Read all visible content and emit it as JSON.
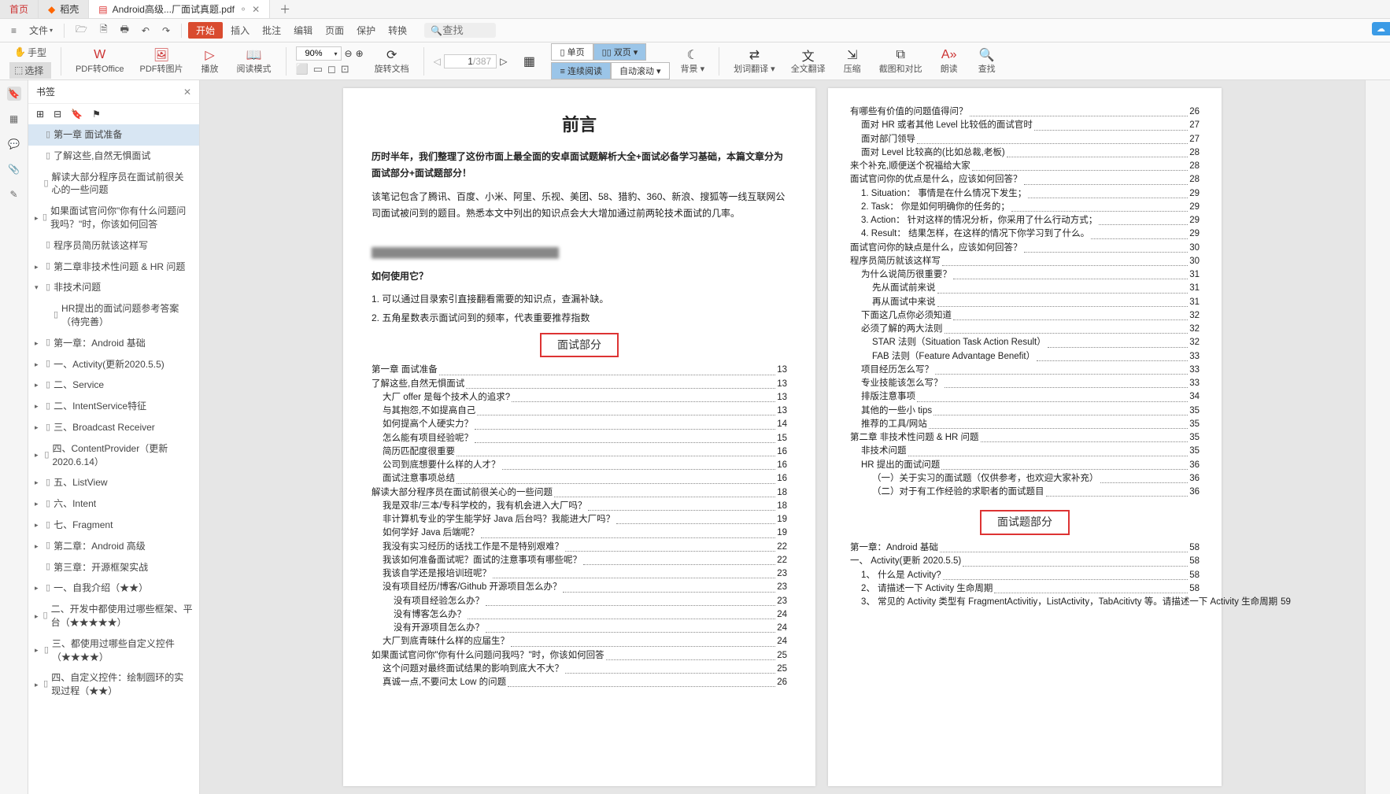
{
  "tabs": {
    "home": "首页",
    "doc1": "稻壳",
    "active": "Android高级...厂面试真题.pdf"
  },
  "menubar": {
    "file": "文件",
    "start": "开始",
    "insert": "插入",
    "review": "批注",
    "edit": "编辑",
    "page": "页面",
    "protect": "保护",
    "convert": "转换",
    "search_placeholder": "查找"
  },
  "toolbar": {
    "hand": "手型",
    "select": "选择",
    "pdf2office": "PDF转Office",
    "pdf2img": "PDF转图片",
    "play": "播放",
    "readmode": "阅读模式",
    "zoom": "90%",
    "rotate": "旋转文档",
    "page_current": "1",
    "page_total": "/387",
    "single": "单页",
    "double": "双页",
    "continuous": "连续阅读",
    "autoscroll": "自动滚动",
    "bg": "背景",
    "dict": "划词翻译",
    "fulltrans": "全文翻译",
    "compress": "压缩",
    "screenshot": "截图和对比",
    "read": "朗读",
    "find": "查找"
  },
  "sidebar": {
    "title": "书签",
    "items": [
      {
        "text": "第一章 面试准备",
        "sel": true,
        "ind": 0,
        "arr": ""
      },
      {
        "text": "了解这些,自然无惧面试",
        "ind": 0,
        "arr": ""
      },
      {
        "text": "解读大部分程序员在面试前很关心的一些问题",
        "ind": 0,
        "arr": ""
      },
      {
        "text": "如果面试官问你\"你有什么问题问我吗？\"时，你该如何回答",
        "ind": 0,
        "arr": "▸"
      },
      {
        "text": "程序员简历就该这样写",
        "ind": 0,
        "arr": ""
      },
      {
        "text": "第二章非技术性问题 & HR 问题",
        "ind": 0,
        "arr": "▸"
      },
      {
        "text": "非技术问题",
        "ind": 0,
        "arr": "▾"
      },
      {
        "text": "HR提出的面试问题参考答案（待完善）",
        "ind": 1,
        "arr": ""
      },
      {
        "text": "第一章：Android 基础",
        "ind": 0,
        "arr": "▸"
      },
      {
        "text": "一、Activity(更新2020.5.5)",
        "ind": 0,
        "arr": "▸"
      },
      {
        "text": "二、Service",
        "ind": 0,
        "arr": "▸"
      },
      {
        "text": "二、IntentService特征",
        "ind": 0,
        "arr": "▸"
      },
      {
        "text": "三、Broadcast Receiver",
        "ind": 0,
        "arr": "▸"
      },
      {
        "text": "四、ContentProvider（更新2020.6.14）",
        "ind": 0,
        "arr": "▸"
      },
      {
        "text": "五、ListView",
        "ind": 0,
        "arr": "▸"
      },
      {
        "text": "六、Intent",
        "ind": 0,
        "arr": "▸"
      },
      {
        "text": "七、Fragment",
        "ind": 0,
        "arr": "▸"
      },
      {
        "text": "第二章：Android 高级",
        "ind": 0,
        "arr": "▸"
      },
      {
        "text": "第三章：开源框架实战",
        "ind": 0,
        "arr": ""
      },
      {
        "text": "一、自我介绍（★★）",
        "ind": 0,
        "arr": "▸"
      },
      {
        "text": "二、开发中都使用过哪些框架、平台（★★★★★）",
        "ind": 0,
        "arr": "▸"
      },
      {
        "text": "三、都使用过哪些自定义控件（★★★★）",
        "ind": 0,
        "arr": "▸"
      },
      {
        "text": "四、自定义控件：绘制圆环的实现过程（★★）",
        "ind": 0,
        "arr": "▸"
      }
    ]
  },
  "doc_left": {
    "title": "前言",
    "p1": "历时半年，我们整理了这份市面上最全面的安卓面试题解析大全+面试必备学习基础，本篇文章分为面试部分+面试题部分！",
    "p2": "该笔记包含了腾讯、百度、小米、阿里、乐视、美团、58、猎豹、360、新浪、搜狐等一线互联网公司面试被问到的题目。熟悉本文中列出的知识点会大大增加通过前两轮技术面试的几率。",
    "h2": "如何使用它？",
    "l1": "1. 可以通过目录索引直接翻看需要的知识点，查漏补缺。",
    "l2": "2. 五角星数表示面试问到的频率，代表重要推荐指数",
    "section": "面试部分",
    "toc": [
      {
        "t": "第一章 面试准备",
        "p": "13",
        "i": 0
      },
      {
        "t": "了解这些,自然无惧面试",
        "p": "13",
        "i": 0
      },
      {
        "t": "大厂 offer 是每个技术人的追求?",
        "p": "13",
        "i": 1
      },
      {
        "t": "与其抱怨,不如提高自己",
        "p": "13",
        "i": 1
      },
      {
        "t": "如何提高个人硬实力？",
        "p": "14",
        "i": 1
      },
      {
        "t": "怎么能有项目经验呢？",
        "p": "15",
        "i": 1
      },
      {
        "t": "简历匹配度很重要",
        "p": "16",
        "i": 1
      },
      {
        "t": "公司到底想要什么样的人才？",
        "p": "16",
        "i": 1
      },
      {
        "t": "面试注意事项总结",
        "p": "16",
        "i": 1
      },
      {
        "t": "解读大部分程序员在面试前很关心的一些问题",
        "p": "18",
        "i": 0
      },
      {
        "t": "我是双非/三本/专科学校的，我有机会进入大厂吗？",
        "p": "18",
        "i": 1
      },
      {
        "t": "非计算机专业的学生能学好 Java 后台吗？我能进大厂吗？",
        "p": "19",
        "i": 1
      },
      {
        "t": "如何学好 Java 后端呢？",
        "p": "19",
        "i": 1
      },
      {
        "t": "我没有实习经历的话找工作是不是特别艰难？",
        "p": "22",
        "i": 1
      },
      {
        "t": "我该如何准备面试呢？面试的注意事项有哪些呢？",
        "p": "22",
        "i": 1
      },
      {
        "t": "我该自学还是报培训班呢？",
        "p": "23",
        "i": 1
      },
      {
        "t": "没有项目经历/博客/Github 开源项目怎么办？",
        "p": "23",
        "i": 1
      },
      {
        "t": "没有项目经验怎么办？",
        "p": "23",
        "i": 2
      },
      {
        "t": "没有博客怎么办？",
        "p": "24",
        "i": 2
      },
      {
        "t": "没有开源项目怎么办？",
        "p": "24",
        "i": 2
      },
      {
        "t": "大厂到底青昧什么样的应届生？",
        "p": "24",
        "i": 1
      },
      {
        "t": "如果面试官问你\"你有什么问题问我吗？\"时，你该如何回答",
        "p": "25",
        "i": 0
      },
      {
        "t": "这个问题对最终面试结果的影响到底大不大？",
        "p": "25",
        "i": 1
      },
      {
        "t": "真诚一点,不要问太 Low 的问题",
        "p": "26",
        "i": 1
      }
    ]
  },
  "doc_right": {
    "toc1": [
      {
        "t": "有哪些有价值的问题值得问？",
        "p": "26",
        "i": 0
      },
      {
        "t": "面对 HR 或者其他 Level 比较低的面试官时",
        "p": "27",
        "i": 1
      },
      {
        "t": "面对部门领导",
        "p": "27",
        "i": 1
      },
      {
        "t": "面对 Level 比较高的(比如总裁,老板)",
        "p": "28",
        "i": 1
      },
      {
        "t": "来个补充,顺便送个祝福给大家",
        "p": "28",
        "i": 0
      },
      {
        "t": "面试官问你的优点是什么，应该如何回答？",
        "p": "28",
        "i": 0
      },
      {
        "t": "1. Situation：  事情是在什么情况下发生；",
        "p": "29",
        "i": 1
      },
      {
        "t": "2. Task：   你是如何明确你的任务的；",
        "p": "29",
        "i": 1
      },
      {
        "t": "3. Action：  针对这样的情况分析，你采用了什么行动方式；",
        "p": "29",
        "i": 1
      },
      {
        "t": "4. Result：  结果怎样，在这样的情况下你学习到了什么。",
        "p": "29",
        "i": 1
      },
      {
        "t": "面试官问你的缺点是什么，应该如何回答？",
        "p": "30",
        "i": 0
      },
      {
        "t": "程序员简历就该这样写",
        "p": "30",
        "i": 0
      },
      {
        "t": "为什么说简历很重要？",
        "p": "31",
        "i": 1
      },
      {
        "t": "先从面试前来说",
        "p": "31",
        "i": 2
      },
      {
        "t": "再从面试中来说",
        "p": "31",
        "i": 2
      },
      {
        "t": "下面这几点你必须知道",
        "p": "32",
        "i": 1
      },
      {
        "t": "必须了解的两大法则",
        "p": "32",
        "i": 1
      },
      {
        "t": "STAR 法则（Situation Task Action Result）",
        "p": "32",
        "i": 2
      },
      {
        "t": "FAB 法则（Feature Advantage Benefit）",
        "p": "33",
        "i": 2
      },
      {
        "t": "项目经历怎么写？",
        "p": "33",
        "i": 1
      },
      {
        "t": "专业技能该怎么写？",
        "p": "33",
        "i": 1
      },
      {
        "t": "排版注意事项",
        "p": "34",
        "i": 1
      },
      {
        "t": "其他的一些小 tips",
        "p": "35",
        "i": 1
      },
      {
        "t": "推荐的工具/网站",
        "p": "35",
        "i": 1
      },
      {
        "t": "第二章 非技术性问题 & HR 问题",
        "p": "35",
        "i": 0
      },
      {
        "t": "非技术问题",
        "p": "35",
        "i": 1
      },
      {
        "t": "HR 提出的面试问题",
        "p": "36",
        "i": 1
      },
      {
        "t": "（一）关于实习的面试题（仅供参考，也欢迎大家补充）",
        "p": "36",
        "i": 2
      },
      {
        "t": "（二）对于有工作经验的求职者的面试题目",
        "p": "36",
        "i": 2
      }
    ],
    "section": "面试题部分",
    "toc2": [
      {
        "t": "第一章：Android 基础",
        "p": "58",
        "i": 0
      },
      {
        "t": "一、 Activity(更新 2020.5.5)",
        "p": "58",
        "i": 0
      },
      {
        "t": "1、 什么是 Activity?",
        "p": "58",
        "i": 1
      },
      {
        "t": "2、 请描述一下 Activity 生命周期",
        "p": "58",
        "i": 1
      },
      {
        "t": "3、 常见的 Activity 类型有 FragmentActivitiy，ListActivity，TabAcitivty 等。请描述一下 Activity 生命周期",
        "p": "59",
        "i": 1
      }
    ]
  }
}
